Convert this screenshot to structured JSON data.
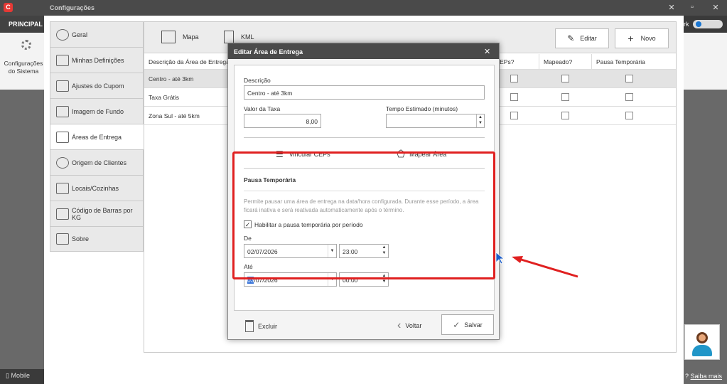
{
  "app": {
    "window_title": "Configurações",
    "logo_letter": "C",
    "minimize": "−",
    "restore": "▫",
    "close": "✕",
    "close_outer": "✕"
  },
  "left": {
    "tab": "PRINCIPAL",
    "ribbon_label": "Configurações do Sistema",
    "mobile": "Mobile"
  },
  "right": {
    "tab_text": "rk",
    "help": "?",
    "saiba": "Saiba mais"
  },
  "sidebar": {
    "items": [
      {
        "label": "Geral",
        "icon": "gear-icon"
      },
      {
        "label": "Minhas Definições",
        "icon": "list-icon"
      },
      {
        "label": "Ajustes do Cupom",
        "icon": "receipt-icon"
      },
      {
        "label": "Imagem de Fundo",
        "icon": "image-icon"
      },
      {
        "label": "Áreas de Entrega",
        "icon": "map-icon"
      },
      {
        "label": "Origem de Clientes",
        "icon": "person-icon"
      },
      {
        "label": "Locais/Cozinhas",
        "icon": "printer-icon"
      },
      {
        "label": "Código de Barras por KG",
        "icon": "barcode-icon"
      },
      {
        "label": "Sobre",
        "icon": "monitor-icon"
      }
    ]
  },
  "toolbar": {
    "mapa": "Mapa",
    "kml": "KML",
    "editar": "Editar",
    "novo": "Novo"
  },
  "grid": {
    "headers": [
      "Descrição da Área de Entrega",
      "CEPs?",
      "Mapeado?",
      "Pausa Temporária"
    ],
    "rows": [
      {
        "descricao": "Centro - até 3km",
        "selected": true
      },
      {
        "descricao": "Taxa Grátis",
        "selected": false
      },
      {
        "descricao": "Zona Sul - até 5km",
        "selected": false
      }
    ]
  },
  "dialog": {
    "title": "Editar Área de Entrega",
    "close": "✕",
    "descricao_label": "Descrição",
    "descricao_value": "Centro - até 3km",
    "taxa_label": "Valor da Taxa",
    "taxa_value": "8,00",
    "tempo_label": "Tempo Estimado (minutos)",
    "tempo_value": "",
    "vincular": "Vincular CEPs",
    "mapear": "Mapear Área",
    "pausa_title": "Pausa Temporária",
    "pausa_hint": "Permite pausar uma área de entrega na data/hora configurada. Durante esse período, a área ficará inativa e será reativada automaticamente após o término.",
    "habilitar_label": "Habilitar a pausa temporária por período",
    "habilitar_checked": "✓",
    "de_label": "De",
    "de_date": "02/07/2026",
    "de_time": "23:00",
    "ate_label": "Até",
    "ate_date_sel": "03",
    "ate_date_rest": "/07/2026",
    "ate_time": "00:00",
    "excluir": "Excluir",
    "voltar": "Voltar",
    "salvar": "Salvar"
  },
  "colors": {
    "highlight": "#e02020",
    "titlebar": "#4a4a4a",
    "selection": "#1976d2"
  }
}
